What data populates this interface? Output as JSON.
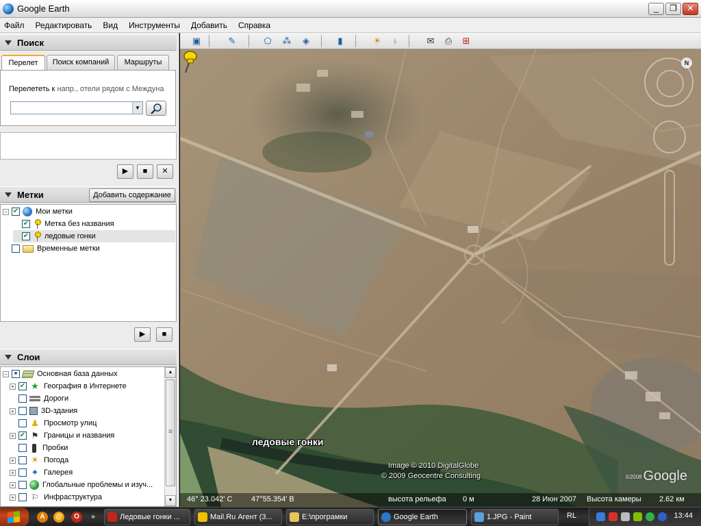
{
  "window": {
    "title": "Google Earth"
  },
  "menu": [
    "Файл",
    "Редактировать",
    "Вид",
    "Инструменты",
    "Добавить",
    "Справка"
  ],
  "search": {
    "header": "Поиск",
    "tabs": [
      "Перелет",
      "Поиск компаний",
      "Маршруты"
    ],
    "fly_label": "Перелететь к",
    "fly_hint": "напр., отели рядом с Междуна",
    "input_value": ""
  },
  "places": {
    "header": "Метки",
    "add_content_label": "Добавить содержание",
    "items": [
      {
        "label": "Мои метки",
        "checked": true,
        "icon": "globe-icon"
      },
      {
        "label": "Метка без названия",
        "checked": true,
        "icon": "placemark-pin-icon"
      },
      {
        "label": "ледовые гонки",
        "checked": true,
        "icon": "placemark-pin-icon",
        "selected": true
      },
      {
        "label": "Временные метки",
        "checked": false,
        "icon": "folder-icon"
      }
    ]
  },
  "layers": {
    "header": "Слои",
    "items": [
      {
        "label": "Основная база данных",
        "checked": "partial",
        "icon": "layers-icon"
      },
      {
        "label": "География в Интернете",
        "checked": true,
        "icon": "star-icon"
      },
      {
        "label": "Дороги",
        "checked": false,
        "icon": "road-icon"
      },
      {
        "label": "3D-здания",
        "checked": false,
        "icon": "building-icon"
      },
      {
        "label": "Просмотр улиц",
        "checked": false,
        "icon": "person-icon"
      },
      {
        "label": "Границы и названия",
        "checked": true,
        "icon": "flag-icon"
      },
      {
        "label": "Пробки",
        "checked": false,
        "icon": "traffic-light-icon"
      },
      {
        "label": "Погода",
        "checked": false,
        "icon": "sun-icon"
      },
      {
        "label": "Галерея",
        "checked": false,
        "icon": "gallery-star-icon"
      },
      {
        "label": "Глобальные проблемы и изуч...",
        "checked": false,
        "icon": "earth-icon"
      },
      {
        "label": "Инфраструктура",
        "checked": false,
        "icon": "flag-icon"
      }
    ]
  },
  "map": {
    "placemark_label": "ледовые гонки",
    "credit_image": "Image © 2010 DigitalGlobe",
    "credit_geo": "© 2009 Geocentre Consulting",
    "brand": "Google",
    "brand_year": "©2008",
    "compass_n": "N",
    "status": {
      "lat": "46° 23.042' С",
      "lon": "47°55.354' В",
      "elev_label": "высота рельефа",
      "elev_value": "0 м",
      "date": "28 Июн 2007",
      "eye_label": "Высота камеры",
      "eye_value": "2.62 км"
    }
  },
  "taskbar": {
    "tasks": [
      "Ледовые гонки ...",
      "Mail.Ru Агент (3...",
      "E:\\програмки",
      "Google Earth",
      "1.JPG - Paint"
    ],
    "lang": "RL",
    "clock": "13:44"
  },
  "colors": {
    "accent_tab": "#f7a534",
    "check_green": "#1f8f1f",
    "terrain": "#9c8a70"
  }
}
